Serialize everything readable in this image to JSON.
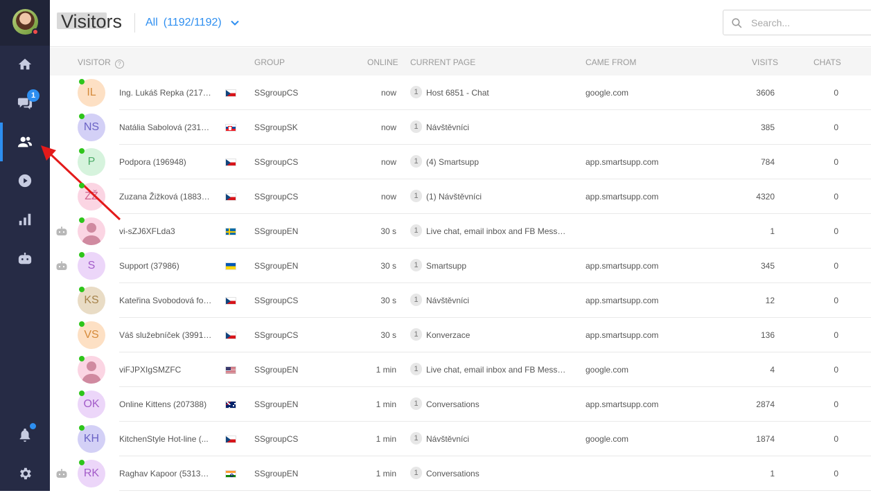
{
  "sidebar": {
    "chats_badge": "1",
    "items": [
      {
        "name": "home-icon"
      },
      {
        "name": "chat-bubbles-icon"
      },
      {
        "name": "visitors-icon"
      },
      {
        "name": "play-icon"
      },
      {
        "name": "bar-chart-icon"
      },
      {
        "name": "robot-icon"
      },
      {
        "name": "bell-icon"
      },
      {
        "name": "gear-icon"
      }
    ],
    "active_item": "visitors-icon"
  },
  "header": {
    "title": "Visitors",
    "filter_label": "All",
    "filter_count": "(1192/1192)",
    "search_placeholder": "Search..."
  },
  "table": {
    "columns": {
      "visitor": "VISITOR",
      "group": "GROUP",
      "online": "ONLINE",
      "current_page": "CURRENT PAGE",
      "came_from": "CAME FROM",
      "visits": "VISITS",
      "chats": "CHATS"
    },
    "rows": [
      {
        "initials": "IL",
        "avatar_bg": "#fde0c4",
        "avatar_fg": "#d58a3a",
        "name": "Ing. Lukáš Repka (2177...",
        "flag": "cz",
        "group": "SSgroupCS",
        "online": "now",
        "page_no": "1",
        "page": "Host 6851 - Chat",
        "came_from": "google.com",
        "visits": "3606",
        "chats": "0",
        "bot": false
      },
      {
        "initials": "NS",
        "avatar_bg": "#d3d0f6",
        "avatar_fg": "#6a63c5",
        "name": "Natália Sabolová (2317...",
        "flag": "sk",
        "group": "SSgroupSK",
        "online": "now",
        "page_no": "1",
        "page": "Návštěvníci",
        "came_from": "",
        "visits": "385",
        "chats": "0",
        "bot": false
      },
      {
        "initials": "P",
        "avatar_bg": "#d6f3dd",
        "avatar_fg": "#4aab66",
        "name": "Podpora (196948)",
        "flag": "cz",
        "group": "SSgroupCS",
        "online": "now",
        "page_no": "1",
        "page": "(4) Smartsupp",
        "came_from": "app.smartsupp.com",
        "visits": "784",
        "chats": "0",
        "bot": false
      },
      {
        "initials": "ZŽ",
        "avatar_bg": "#fbd5e3",
        "avatar_fg": "#d0628d",
        "name": "Zuzana Žižková (188319)",
        "flag": "cz",
        "group": "SSgroupCS",
        "online": "now",
        "page_no": "1",
        "page": "(1) Návštěvníci",
        "came_from": "app.smartsupp.com",
        "visits": "4320",
        "chats": "0",
        "bot": false
      },
      {
        "initials": "",
        "avatar_bg": "#fbd5e3",
        "avatar_fg": "#d08aa0",
        "name": "vi-sZJ6XFLda3",
        "flag": "se",
        "group": "SSgroupEN",
        "online": "30 s",
        "page_no": "1",
        "page": "Live chat, email inbox and FB Messe...",
        "came_from": "",
        "visits": "1",
        "chats": "0",
        "bot": true,
        "placeholder": true
      },
      {
        "initials": "S",
        "avatar_bg": "#ecd6f9",
        "avatar_fg": "#a35cc9",
        "name": "Support (37986)",
        "flag": "ua",
        "group": "SSgroupEN",
        "online": "30 s",
        "page_no": "1",
        "page": "Smartsupp",
        "came_from": "app.smartsupp.com",
        "visits": "345",
        "chats": "0",
        "bot": true
      },
      {
        "initials": "KS",
        "avatar_bg": "#e9dcc5",
        "avatar_fg": "#a5824a",
        "name": "Kateřina Svobodová fot...",
        "flag": "cz",
        "group": "SSgroupCS",
        "online": "30 s",
        "page_no": "1",
        "page": "Návštěvníci",
        "came_from": "app.smartsupp.com",
        "visits": "12",
        "chats": "0",
        "bot": false
      },
      {
        "initials": "VS",
        "avatar_bg": "#fde0c4",
        "avatar_fg": "#d58a3a",
        "name": "Váš služebníček (399175)",
        "flag": "cz",
        "group": "SSgroupCS",
        "online": "30 s",
        "page_no": "1",
        "page": "Konverzace",
        "came_from": "app.smartsupp.com",
        "visits": "136",
        "chats": "0",
        "bot": false
      },
      {
        "initials": "",
        "avatar_bg": "#fbd5e3",
        "avatar_fg": "#d08aa0",
        "name": "viFJPXIgSMZFC",
        "flag": "us",
        "group": "SSgroupEN",
        "online": "1 min",
        "page_no": "1",
        "page": "Live chat, email inbox and FB Messe...",
        "came_from": "google.com",
        "visits": "4",
        "chats": "0",
        "bot": false,
        "placeholder": true
      },
      {
        "initials": "OK",
        "avatar_bg": "#ecd6f9",
        "avatar_fg": "#a35cc9",
        "name": "Online Kittens (207388)",
        "flag": "au",
        "group": "SSgroupEN",
        "online": "1 min",
        "page_no": "1",
        "page": "Conversations",
        "came_from": "app.smartsupp.com",
        "visits": "2874",
        "chats": "0",
        "bot": false
      },
      {
        "initials": "KH",
        "avatar_bg": "#d3d0f6",
        "avatar_fg": "#6a63c5",
        "name": "KitchenStyle Hot-line (...",
        "flag": "cz",
        "group": "SSgroupCS",
        "online": "1 min",
        "page_no": "1",
        "page": "Návštěvníci",
        "came_from": "google.com",
        "visits": "1874",
        "chats": "0",
        "bot": false
      },
      {
        "initials": "RK",
        "avatar_bg": "#ecd6f9",
        "avatar_fg": "#a35cc9",
        "name": "Raghav Kapoor (531318)",
        "flag": "in",
        "group": "SSgroupEN",
        "online": "1 min",
        "page_no": "1",
        "page": "Conversations",
        "came_from": "",
        "visits": "1",
        "chats": "0",
        "bot": true
      }
    ]
  },
  "colors": {
    "sidebar_bg": "#262b45",
    "accent": "#2d8ef0",
    "online": "#2ec51b",
    "annotation_arrow": "#e31a1a"
  }
}
